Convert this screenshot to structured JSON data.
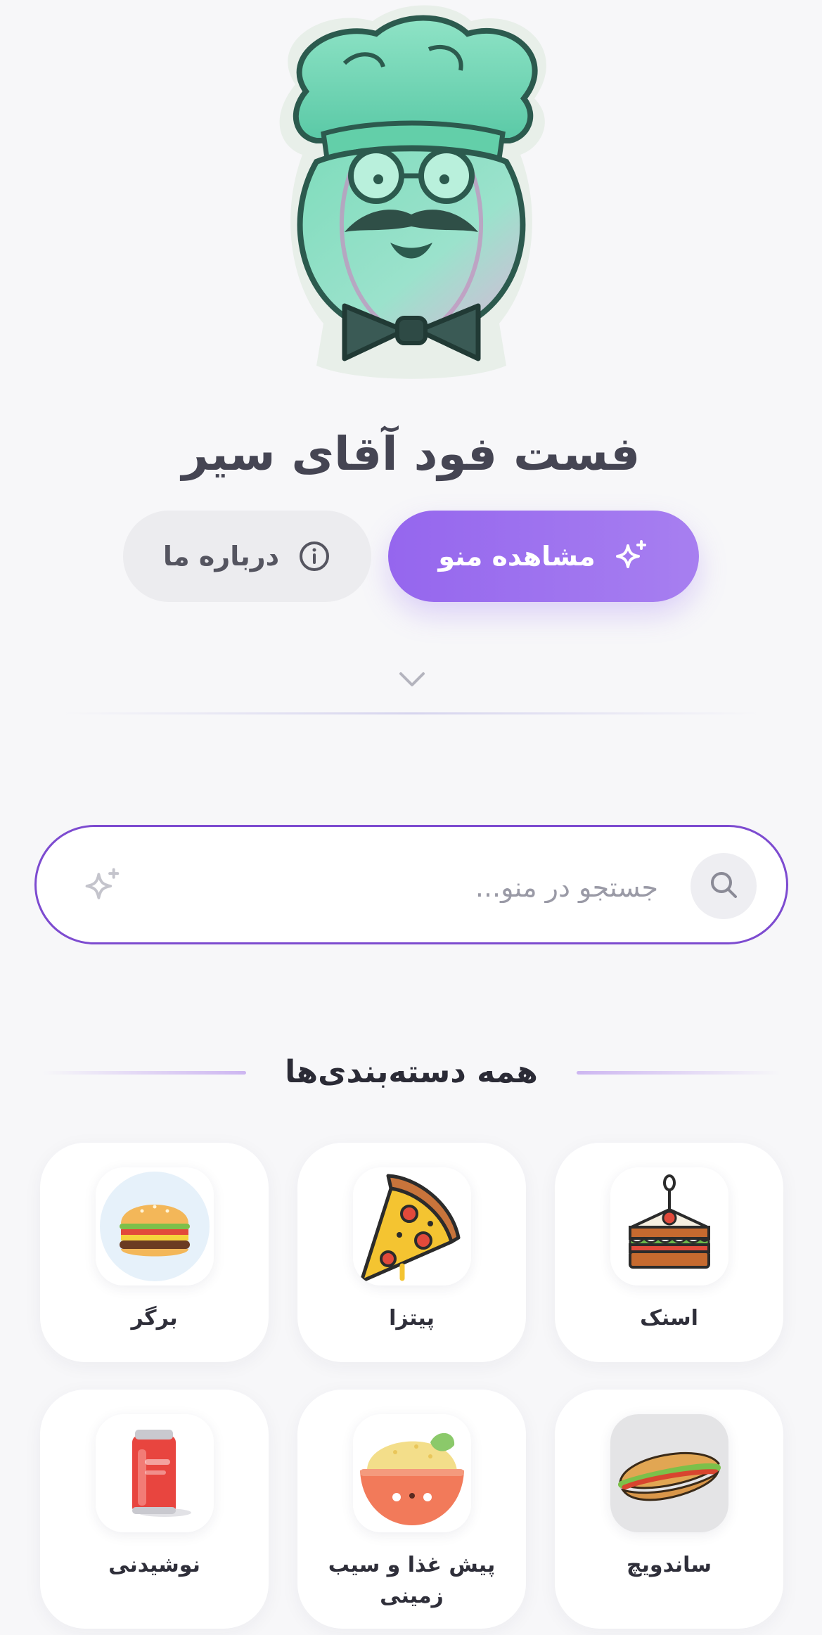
{
  "header": {
    "title": "فست فود آقای سیر"
  },
  "actions": {
    "menu_label": "مشاهده منو",
    "about_label": "درباره ما"
  },
  "search": {
    "placeholder": "جستجو در منو..."
  },
  "categories_section": {
    "title": "همه دسته‌بندی‌ها",
    "items": [
      {
        "label": "اسنک",
        "icon": "snack-sandwich-icon"
      },
      {
        "label": "پیتزا",
        "icon": "pizza-slice-icon"
      },
      {
        "label": "برگر",
        "icon": "burger-icon"
      },
      {
        "label": "ساندویچ",
        "icon": "sub-sandwich-icon"
      },
      {
        "label": "پیش غذا و سیب زمینی",
        "icon": "appetizer-bowl-icon"
      },
      {
        "label": "نوشیدنی",
        "icon": "soda-can-icon"
      }
    ]
  },
  "colors": {
    "accent": "#9566ee",
    "search_border": "#7d4bd0",
    "background": "#f7f7f9"
  }
}
